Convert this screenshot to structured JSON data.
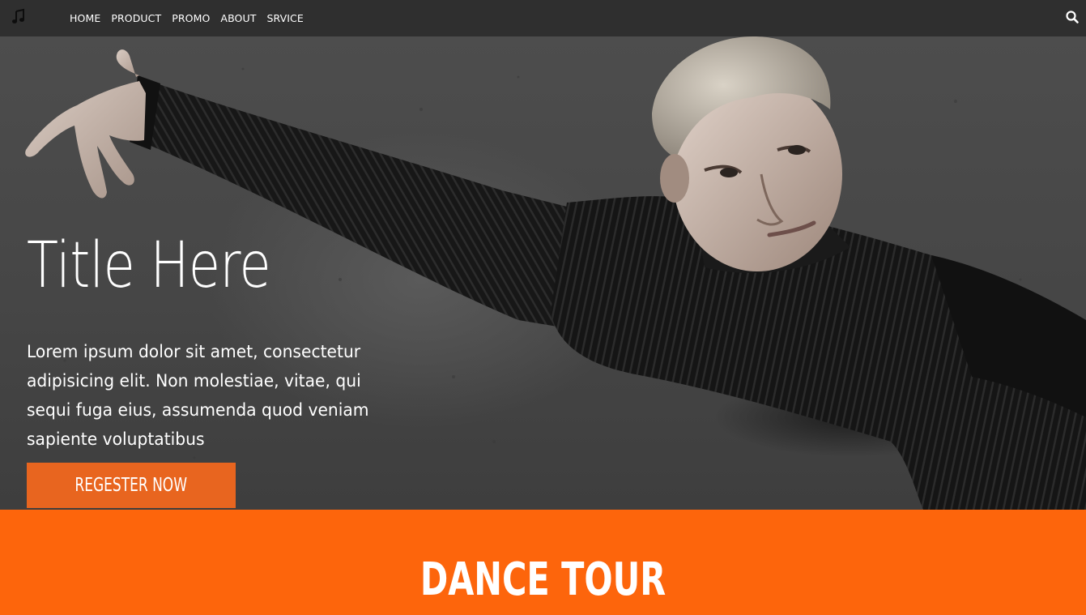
{
  "nav": {
    "logo_icon": "music-note-icon",
    "links": [
      "HOME",
      "PRODUCT",
      "PROMO",
      "ABOUT",
      "SRVICE"
    ],
    "search_icon": "search-icon"
  },
  "hero": {
    "title": "Title Here",
    "text": "Lorem ipsum dolor sit amet, consectetur adipisicing elit. Non molestiae, vitae, qui sequi fuga eius, assumenda quod veniam sapiente voluptatibus",
    "button_label": "REGESTER NOW",
    "image": "photo of a dancer in black ribbed sweater with arm outstretched"
  },
  "banner": {
    "title": "DANCE TOUR"
  },
  "colors": {
    "navbar": "#2f2f2f",
    "accent": "#fd650c",
    "button": "#e8651f",
    "text": "#ffffff"
  }
}
